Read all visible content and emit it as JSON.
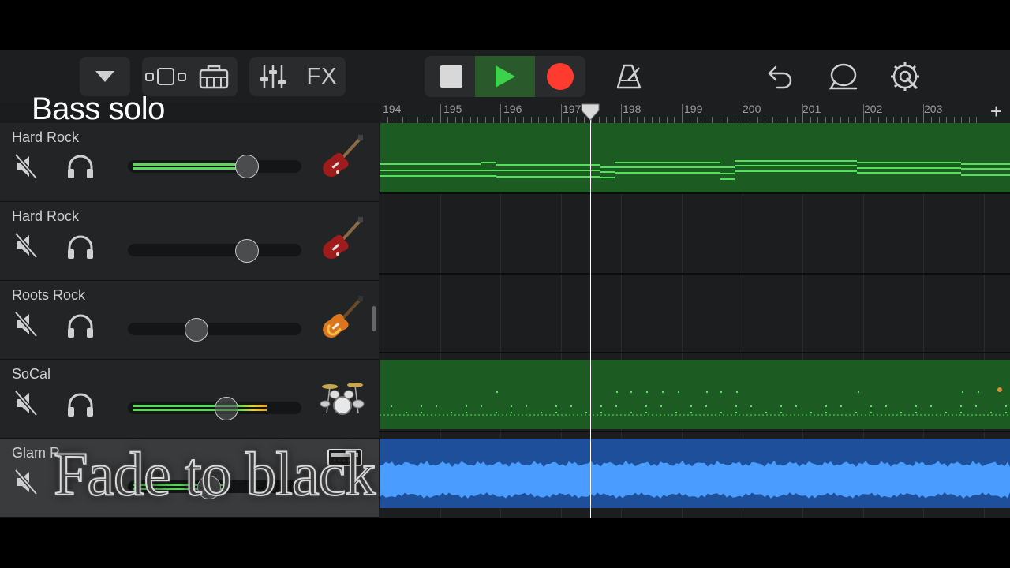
{
  "overlay_title": "Bass solo",
  "caption": "Fade to black",
  "toolbar": {
    "fx_label": "FX"
  },
  "ruler": {
    "bars": [
      "194",
      "195",
      "196",
      "197",
      "198",
      "199",
      "200",
      "201",
      "202",
      "203"
    ],
    "add_symbol": "+"
  },
  "tracks": [
    {
      "name": "Hard Rock",
      "instrument_icon": "electric-guitar-red-icon",
      "volume_percent": 65,
      "selected": false
    },
    {
      "name": "Hard Rock",
      "instrument_icon": "electric-guitar-red-icon",
      "volume_percent": 65,
      "selected": false
    },
    {
      "name": "Roots Rock",
      "instrument_icon": "electric-guitar-sunburst-icon",
      "volume_percent": 38,
      "selected": false
    },
    {
      "name": "SoCal",
      "instrument_icon": "drum-kit-icon",
      "volume_percent": 56,
      "selected": false
    },
    {
      "name": "Glam R",
      "instrument_icon": "amp-icon",
      "volume_percent": 40,
      "selected": true
    }
  ],
  "colors": {
    "region_green": "#1c5b21",
    "region_blue": "#1d4f9a",
    "waveform_blue": "#4a9dff",
    "record_red": "#ff3b30",
    "play_green": "#3ed14b"
  }
}
